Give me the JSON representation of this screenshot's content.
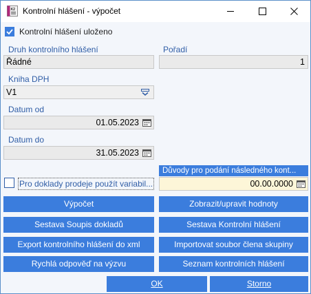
{
  "window": {
    "title": "Kontrolní hlášení - výpočet"
  },
  "saved_checkbox": {
    "label": "Kontrolní hlášení uloženo",
    "checked": true
  },
  "fields": {
    "druh_label": "Druh kontrolního hlášení",
    "druh_value": "Řádné",
    "poradi_label": "Pořadí",
    "poradi_value": "1",
    "kniha_label": "Kniha DPH",
    "kniha_value": "V1",
    "datum_od_label": "Datum od",
    "datum_od_value": "01.05.2023",
    "datum_do_label": "Datum do",
    "datum_do_value": "31.05.2023"
  },
  "duvody": {
    "header": "Důvody pro podání následného kont...",
    "value": "00.00.0000"
  },
  "variable_checkbox": {
    "label": "Pro doklady prodeje použít variabil...",
    "checked": false
  },
  "buttons": {
    "vypocet": "Výpočet",
    "zobrazit": "Zobrazit/upravit hodnoty",
    "sestava_soupis": "Sestava Soupis dokladů",
    "sestava_kh": "Sestava Kontrolní hlášení",
    "export": "Export kontrolního hlášení do xml",
    "importovat": "Importovat soubor člena skupiny",
    "rychla": "Rychlá odpověď na výzvu",
    "seznam": "Seznam kontrolních hlášení",
    "ok": "OK",
    "storno": "Storno"
  },
  "colors": {
    "accent": "#3b7ddd",
    "label": "#2f5da6",
    "highlight_field": "#fdf6d8"
  }
}
